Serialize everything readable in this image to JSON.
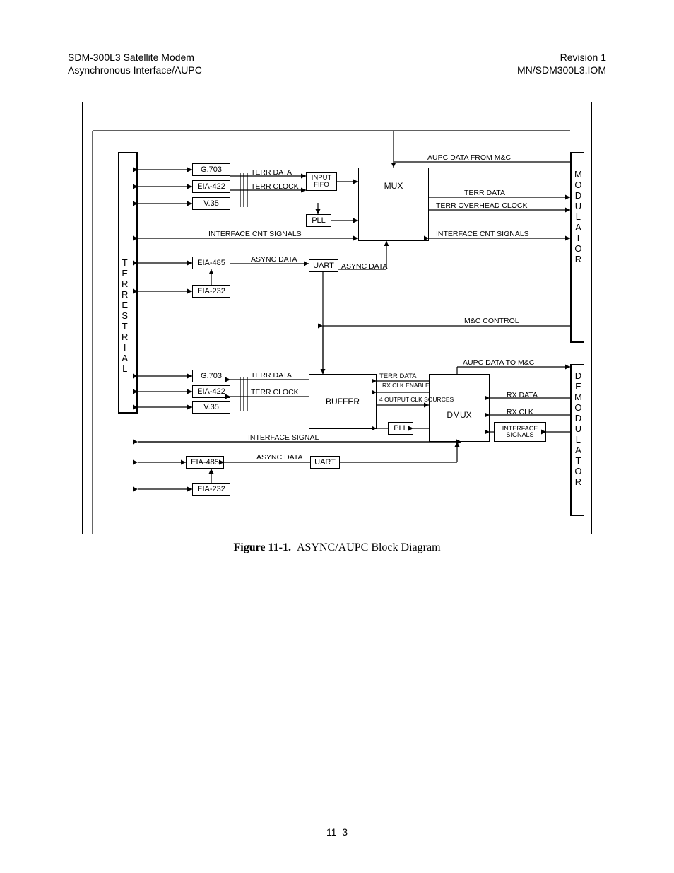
{
  "header": {
    "left_line1": "SDM-300L3 Satellite Modem",
    "left_line2": "Asynchronous Interface/AUPC",
    "right_line1": "Revision 1",
    "right_line2": "MN/SDM300L3.IOM"
  },
  "caption": {
    "num": "Figure 11-1.",
    "title": "ASYNC/AUPC Block Diagram"
  },
  "footer": {
    "page": "11–3"
  },
  "diagram": {
    "vertical": {
      "terrestrial": "TERRESTRIAL",
      "modulator": "MODULATOR",
      "demodulator": "DEMODULATOR"
    },
    "top": {
      "g703": "G.703",
      "eia422": "EIA-422",
      "v35": "V.35",
      "eia485": "EIA-485",
      "eia232": "EIA-232",
      "input_fifo": "INPUT FIFO",
      "pll": "PLL",
      "mux": "MUX",
      "uart": "UART",
      "terr_data": "TERR DATA",
      "terr_clock": "TERR CLOCK",
      "terr_data_r": "TERR DATA",
      "terr_oh_clock": "TERR OVERHEAD CLOCK",
      "iface_cnt_l": "INTERFACE CNT SIGNALS",
      "iface_cnt_r": "INTERFACE CNT SIGNALS",
      "async_data_l": "ASYNC DATA",
      "async_data_r": "ASYNC DATA",
      "aupc_from_mc": "AUPC DATA FROM M&C",
      "mc_control": "M&C CONTROL"
    },
    "bottom": {
      "g703": "G.703",
      "eia422": "EIA-422",
      "v35": "V.35",
      "eia485": "EIA-485",
      "eia232": "EIA-232",
      "buffer": "BUFFER",
      "dmux": "DMUX",
      "pll": "PLL",
      "uart": "UART",
      "interface_signals_box": "INTERFACE SIGNALS",
      "terr_data_l": "TERR DATA",
      "terr_clock_l": "TERR CLOCK",
      "terr_data_r": "TERR DATA",
      "rx_clk_enable": "RX CLK ENABLE",
      "four_output": "4 OUTPUT CLK SOURCES",
      "rx_data": "RX DATA",
      "rx_clk": "RX CLK",
      "interface_signal": "INTERFACE SIGNAL",
      "async_data": "ASYNC DATA",
      "aupc_to_mc": "AUPC DATA TO M&C"
    }
  }
}
